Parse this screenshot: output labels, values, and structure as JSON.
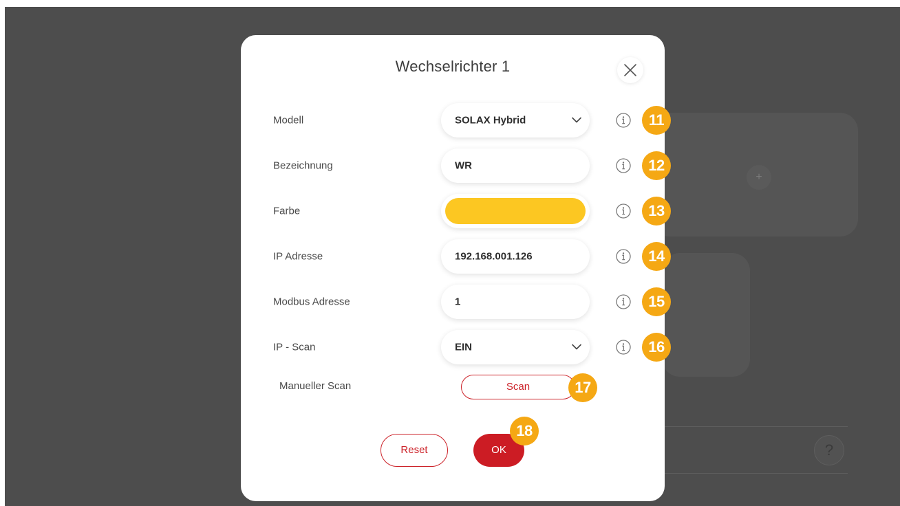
{
  "dialog": {
    "title": "Wechselrichter 1",
    "ok_label": "OK",
    "reset_label": "Reset",
    "ok_badge": "18"
  },
  "fields": [
    {
      "label": "Modell",
      "value": "SOLAX Hybrid",
      "type": "select",
      "badge": "11"
    },
    {
      "label": "Bezeichnung",
      "value": "WR",
      "type": "text",
      "badge": "12"
    },
    {
      "label": "Farbe",
      "value": "#fcc722",
      "type": "color",
      "badge": "13"
    },
    {
      "label": "IP Adresse",
      "value": "192.168.001.126",
      "type": "text",
      "badge": "14"
    },
    {
      "label": "Modbus Adresse",
      "value": "1",
      "type": "text",
      "badge": "15"
    },
    {
      "label": "IP - Scan",
      "value": "EIN",
      "type": "select",
      "badge": "16"
    }
  ],
  "scan": {
    "label": "Manueller Scan",
    "button_label": "Scan",
    "badge": "17"
  },
  "background": {
    "plus": "+",
    "help": "?"
  },
  "colors": {
    "accent": "#cc1c24",
    "badge": "#f5a814",
    "color_swatch": "#fcc722",
    "backdrop": "#4d4d4d"
  },
  "icons": {
    "close": "close-icon",
    "info": "info-icon",
    "chevron": "chevron-down-icon"
  }
}
